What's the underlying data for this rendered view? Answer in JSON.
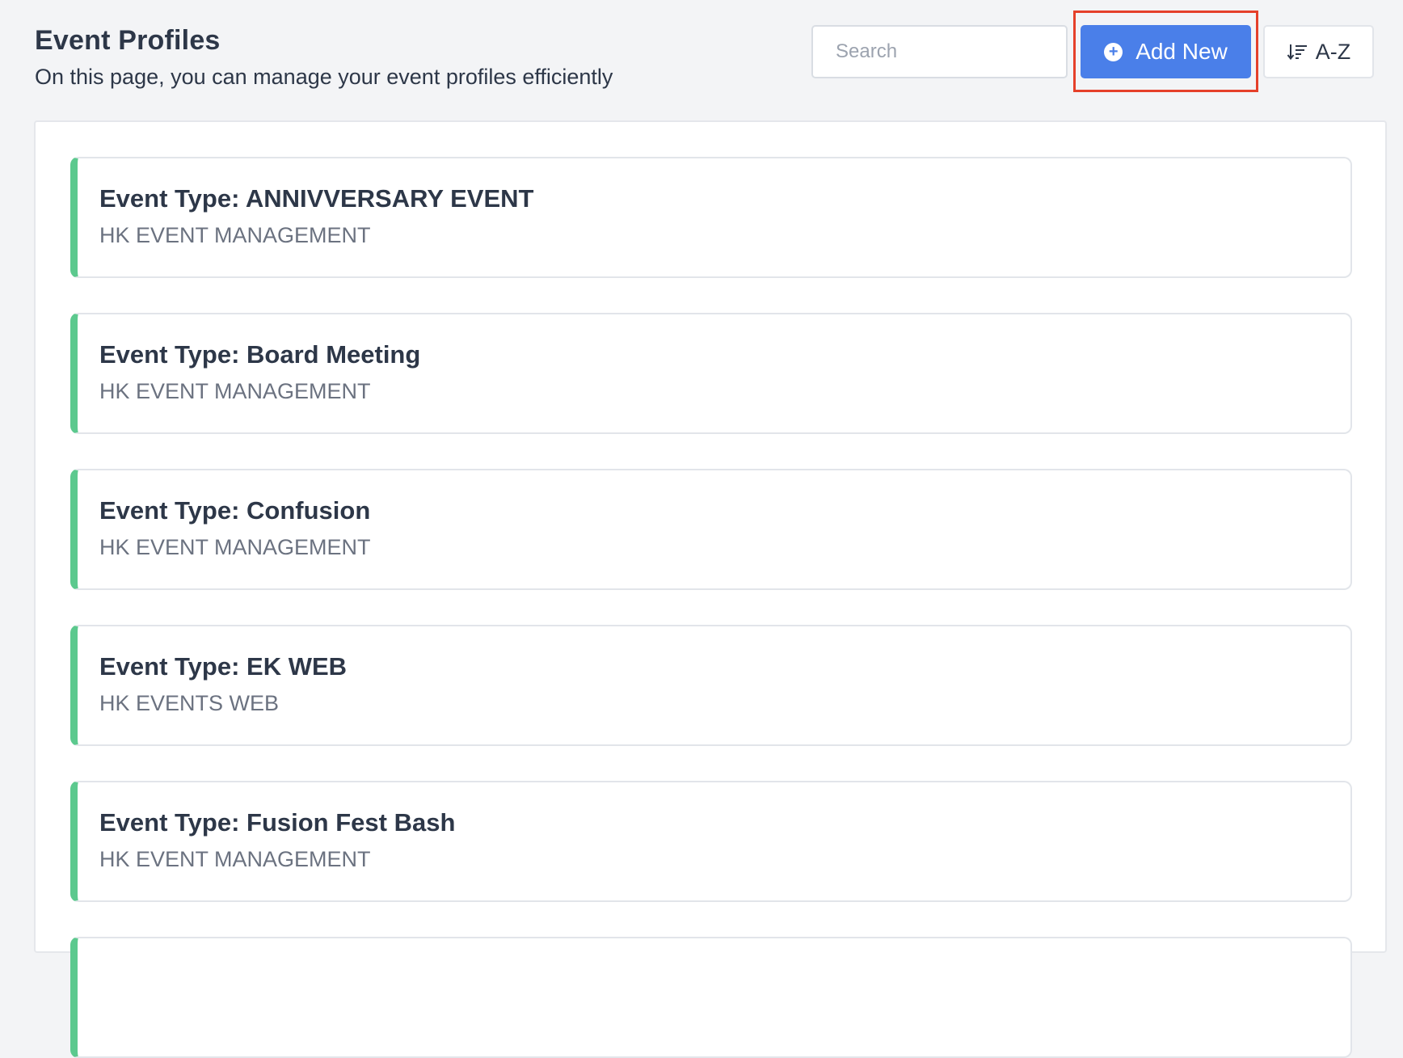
{
  "header": {
    "title": "Event Profiles",
    "subtitle": "On this page, you can manage your event profiles efficiently"
  },
  "toolbar": {
    "search_placeholder": "Search",
    "search_value": "",
    "add_label": "Add New",
    "add_icon": "plus-circle-icon",
    "sort_label": "A-Z",
    "sort_icon": "sort-descending-icon",
    "add_button_color": "#4a7fe9",
    "highlight_color": "#e5402a"
  },
  "profiles": [
    {
      "title": "Event Type: ANNIVVERSARY EVENT",
      "organizer": "HK EVENT MANAGEMENT"
    },
    {
      "title": "Event Type: Board Meeting",
      "organizer": "HK EVENT MANAGEMENT"
    },
    {
      "title": "Event Type: Confusion",
      "organizer": "HK EVENT MANAGEMENT"
    },
    {
      "title": "Event Type: EK WEB",
      "organizer": "HK EVENTS WEB"
    },
    {
      "title": "Event Type: Fusion Fest Bash",
      "organizer": "HK EVENT MANAGEMENT"
    }
  ],
  "colors": {
    "card_accent": "#5cc98e",
    "background": "#f3f4f6"
  }
}
